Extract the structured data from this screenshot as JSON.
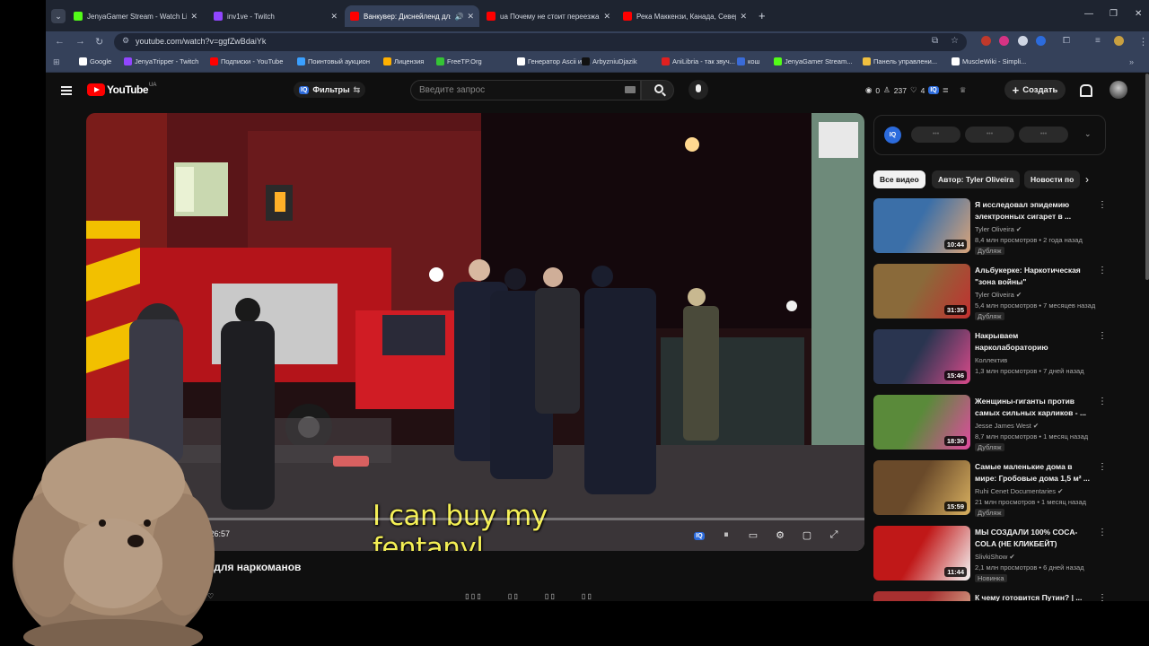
{
  "browser": {
    "tabs": [
      {
        "title": "JenyaGamer Stream - Watch Li",
        "favicon_color": "#53fc18",
        "active": false,
        "speaker": false
      },
      {
        "title": "inv1ve - Twitch",
        "favicon_color": "#9146ff",
        "active": false,
        "speaker": false
      },
      {
        "title": "Ванкувер: Диснейленд для",
        "favicon_color": "#ff0000",
        "active": true,
        "speaker": true
      },
      {
        "title": "ua Почему не стоит переезжа",
        "favicon_color": "#ff0000",
        "active": false,
        "speaker": false
      },
      {
        "title": "Река Маккензи, Канада, Север",
        "favicon_color": "#ff0000",
        "active": false,
        "speaker": false
      }
    ],
    "url": "youtube.com/watch?v=ggfZwBdaiYk",
    "bookmarks": [
      {
        "label": "Google",
        "color": "#ffffff"
      },
      {
        "label": "JenyaTripper - Twitch",
        "color": "#9146ff"
      },
      {
        "label": "Подписки - YouTube",
        "color": "#ff0000"
      },
      {
        "label": "Поинтовый аукцион",
        "color": "#3aa0ff"
      },
      {
        "label": "Лицензия",
        "color": "#ffb000"
      },
      {
        "label": "FreeTP.Org",
        "color": "#35c435"
      },
      {
        "label": "Генератор Ascii из...",
        "color": "#ffffff"
      },
      {
        "label": "ArbyzniuDjazik",
        "color": "#111111"
      },
      {
        "label": "AniLibria - так звуч...",
        "color": "#e02020"
      },
      {
        "label": "кош",
        "color": "#3a6bd8"
      },
      {
        "label": "JenyaGamer Stream...",
        "color": "#53fc18"
      },
      {
        "label": "Панель управлени...",
        "color": "#f0c040"
      },
      {
        "label": "MuscleWiki - Simpli...",
        "color": "#ffffff"
      }
    ]
  },
  "youtube": {
    "logo_text": "YouTube",
    "logo_region": "UA",
    "filters_label": "Фильтры",
    "search_placeholder": "Введите запрос",
    "stats": {
      "a": "0",
      "b": "237",
      "c": "4"
    },
    "create_label": "Создать",
    "player": {
      "caption": "I can buy my fentanyl",
      "time": "7 / 26:57",
      "progress": 0.0043
    },
    "video_title": "нд для наркоманов",
    "ext_panel": {
      "iq_label": "IQ",
      "pills": [
        "•••",
        "•••",
        "•••"
      ]
    },
    "chips": [
      {
        "label": "Все видео",
        "selected": true
      },
      {
        "label": "Автор: Tyler Oliveira",
        "selected": false
      },
      {
        "label": "Новости по",
        "selected": false
      }
    ],
    "recommendations": [
      {
        "title": "Я исследовал эпидемию электронных сигарет в ...",
        "channel": "Tyler Oliveira",
        "verified": true,
        "meta": "8,4 млн просмотров • 2 года назад",
        "badge": "Дубляж",
        "duration": "10:44",
        "thumb_colors": [
          "#3b6fa8",
          "#d9a47a"
        ]
      },
      {
        "title": "Альбукерке: Наркотическая \"зона войны\"",
        "channel": "Tyler Oliveira",
        "verified": true,
        "meta": "5,4 млн просмотров • 7 месяцев назад",
        "badge": "Дубляж",
        "duration": "31:35",
        "thumb_colors": [
          "#8a6a3a",
          "#c23030"
        ]
      },
      {
        "title": "Накрываем нарколабораторию",
        "channel": "Коллектив",
        "verified": false,
        "meta": "1,3 млн просмотров • 7 дней назад",
        "badge": "",
        "duration": "15:46",
        "thumb_colors": [
          "#2a3550",
          "#d84a8a"
        ]
      },
      {
        "title": "Женщины-гиганты против самых сильных карликов - ...",
        "channel": "Jesse James West",
        "verified": true,
        "meta": "8,7 млн просмотров • 1 месяц назад",
        "badge": "Дубляж",
        "duration": "18:30",
        "thumb_colors": [
          "#5a8a3a",
          "#e04aa0"
        ]
      },
      {
        "title": "Самые маленькие дома в мире: Гробовые дома 1,5 м² ...",
        "channel": "Ruhi Cenet Documentaries",
        "verified": true,
        "meta": "21 млн просмотров • 1 месяц назад",
        "badge": "Дубляж",
        "duration": "15:59",
        "thumb_colors": [
          "#6a4a2a",
          "#d8b060"
        ]
      },
      {
        "title": "МЫ СОЗДАЛИ 100% COCA-COLA (НЕ КЛИКБЕЙТ)",
        "channel": "SlivkiShow",
        "verified": true,
        "meta": "2,1 млн просмотров • 6 дней назад",
        "badge": "Новинка",
        "duration": "11:44",
        "thumb_colors": [
          "#c01818",
          "#f4f4f4"
        ]
      },
      {
        "title": "К чему готовится Путин? | ...",
        "channel": "",
        "verified": false,
        "meta": "",
        "badge": "",
        "duration": "",
        "thumb_colors": [
          "#a83030",
          "#e0c0a0"
        ]
      }
    ]
  }
}
